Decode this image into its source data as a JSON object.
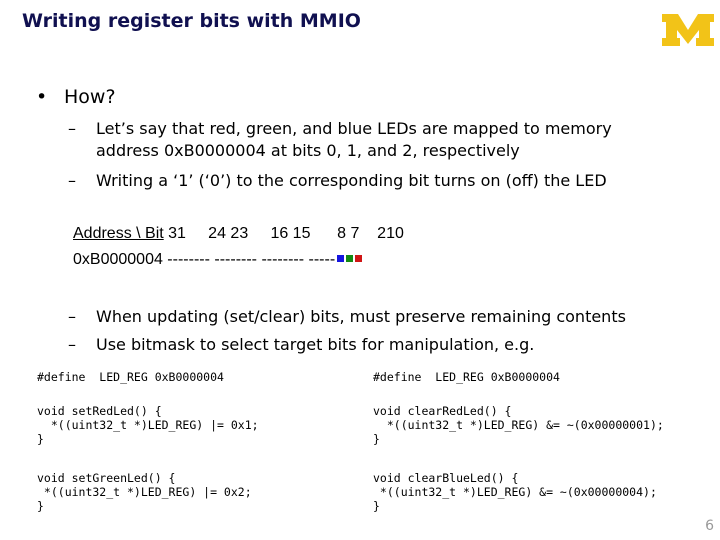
{
  "slide": {
    "title": "Writing register bits with MMIO",
    "logo": "university-of-michigan-block-m-logo",
    "page_number": "6",
    "bullet": {
      "marker": "•",
      "text": "How?"
    },
    "sub_items_top": [
      {
        "marker": "–",
        "lines": [
          "Let’s say that red, green, and blue LEDs are mapped to memory",
          "address 0xB0000004 at bits 0, 1, and 2, respectively"
        ]
      },
      {
        "marker": "–",
        "lines": [
          "Writing a ‘1’ (‘0’) to the corresponding bit turns on (off) the LED"
        ]
      }
    ],
    "register_diagram": {
      "header_label": "Address \\ Bit",
      "header_bits": " 31     24 23     16 15      8 7    210",
      "address": "0xB0000004",
      "dashes": " -------- -------- -------- -----",
      "bit_colors": [
        {
          "bit": 2,
          "led": "blue",
          "color": "#1515e0"
        },
        {
          "bit": 1,
          "led": "green",
          "color": "#138a13"
        },
        {
          "bit": 0,
          "led": "red",
          "color": "#d01515"
        }
      ]
    },
    "sub_items_bottom": [
      {
        "marker": "–",
        "text": "When updating (set/clear) bits, must preserve remaining contents"
      },
      {
        "marker": "–",
        "text": "Use bitmask to select target bits for manipulation, e.g."
      }
    ],
    "code_left": {
      "define": "#define  LED_REG 0xB0000004",
      "block1": "void setRedLed() {\n  *((uint32_t *)LED_REG) |= 0x1;\n}",
      "block2": "void setGreenLed() {\n *((uint32_t *)LED_REG) |= 0x2;\n}"
    },
    "code_right": {
      "define": "#define  LED_REG 0xB0000004",
      "block1": "void clearRedLed() {\n  *((uint32_t *)LED_REG) &= ~(0x00000001);\n}",
      "block2": "void clearBlueLed() {\n *((uint32_t *)LED_REG) &= ~(0x00000004);\n}"
    },
    "colors": {
      "title": "#101050",
      "logo": "#f2c318",
      "page_number": "#999999"
    }
  }
}
